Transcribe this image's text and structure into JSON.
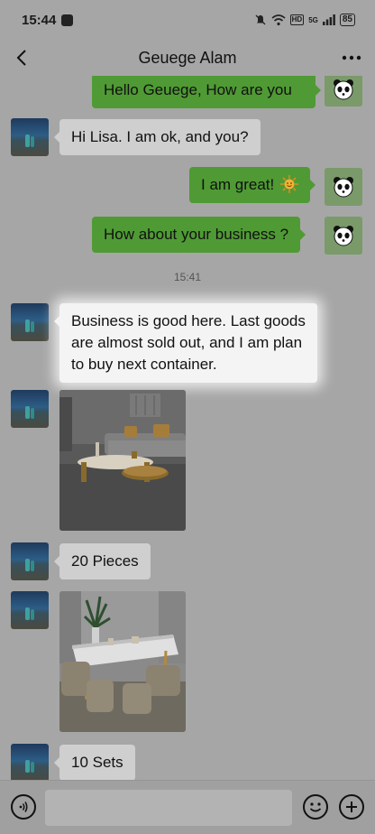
{
  "status_bar": {
    "time": "15:44",
    "network": "5G",
    "hd": "HD",
    "battery": "85"
  },
  "header": {
    "title": "Geuege Alam"
  },
  "messages": [
    {
      "text": "Hello Geuege, How are you"
    },
    {
      "text": "Hi Lisa. I am ok, and you?"
    },
    {
      "text": "I am great!",
      "emoji": "sun-emoji"
    },
    {
      "text": "How about your business ?"
    },
    {
      "text": "Business is good here. Last goods are almost sold out, and I am plan to buy next container."
    },
    {
      "text": "20 Pieces"
    },
    {
      "text": "10 Sets"
    }
  ],
  "timestamp": "15:41",
  "photos": [
    {
      "alt": "living-room-sofa-photo"
    },
    {
      "alt": "dining-table-photo"
    }
  ],
  "input": {
    "placeholder": ""
  },
  "icons": {
    "back": "chevron-left-icon",
    "more": "more-icon",
    "voice": "voice-icon",
    "emoji": "emoji-icon",
    "plus": "plus-icon"
  },
  "colors": {
    "outgoing_bubble": "#4f9a34",
    "incoming_bubble": "#cfcfcf",
    "background": "#a6a6a6"
  }
}
